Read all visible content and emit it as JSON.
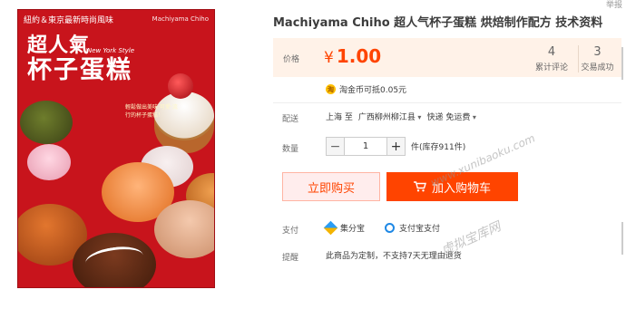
{
  "cover": {
    "top_text": "紐約＆東京最新時尚風味",
    "publisher": "Machiyama Chiho",
    "title_line1": "超人氣",
    "title_line2": "杯子蛋糕",
    "subtitle": "New York Style",
    "blurb": "輕鬆做出美味·可愛·流行的杯子蛋糕！"
  },
  "product": {
    "title": "Machiyama Chiho 超人气杯子蛋糕 烘焙制作配方 技术资料",
    "corner_link": "举报"
  },
  "price": {
    "label": "价格",
    "currency": "¥",
    "value": "1.00",
    "reviews_count": "4",
    "reviews_label": "累计评论",
    "sales_count": "3",
    "sales_label": "交易成功"
  },
  "coin": {
    "icon": "coin-icon",
    "text": "淘金币可抵0.05元"
  },
  "shipping": {
    "label": "配送",
    "from": "上海 至",
    "to": "广西柳州柳江县",
    "method": "快递 免运费"
  },
  "quantity": {
    "label": "数量",
    "minus": "−",
    "value": "1",
    "plus": "+",
    "stock": "件(库存911件)"
  },
  "actions": {
    "buy_now": "立即购买",
    "add_to_cart": "加入购物车"
  },
  "payment": {
    "label": "支付",
    "method1": "集分宝",
    "method2": "支付宝支付"
  },
  "notice": {
    "label": "提醒",
    "text": "此商品为定制，不支持7天无理由退货"
  },
  "watermark": {
    "url": "www.xunibaoku.com",
    "cn": "虚拟宝库网"
  },
  "colors": {
    "accent": "#ff4400",
    "price_bg": "#fff2e8",
    "cover_red": "#c8141c"
  }
}
